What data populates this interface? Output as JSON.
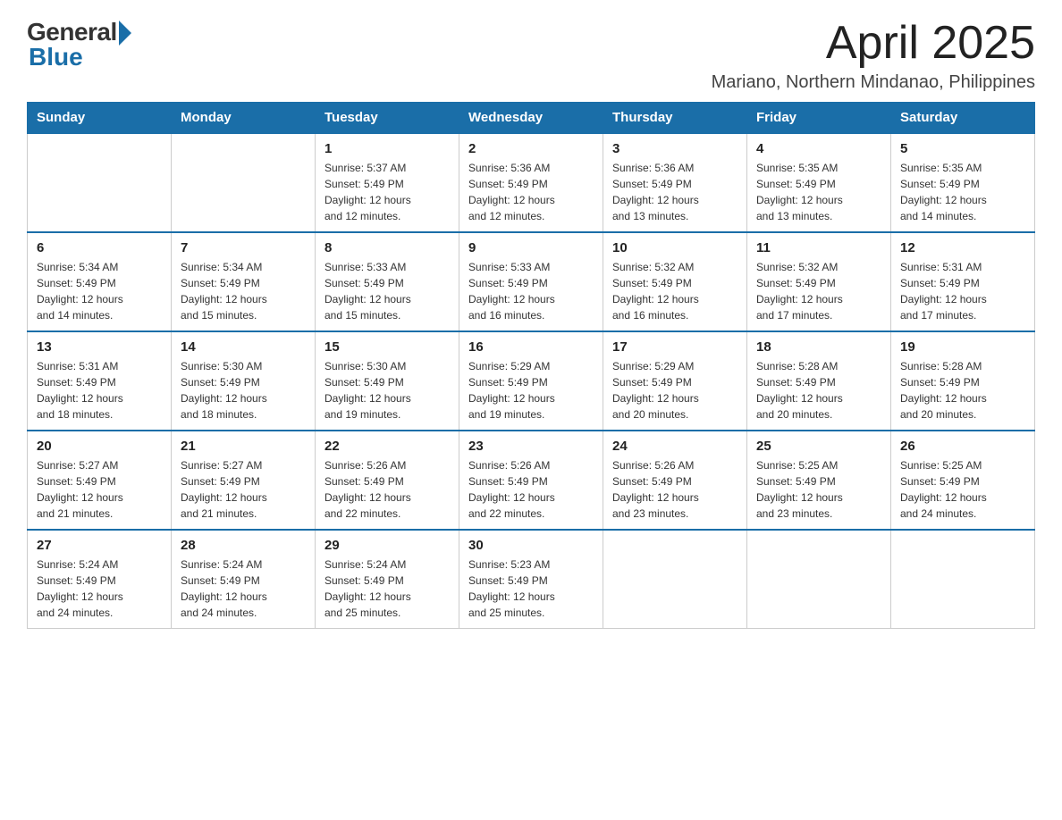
{
  "header": {
    "logo_general": "General",
    "logo_blue": "Blue",
    "month_year": "April 2025",
    "location": "Mariano, Northern Mindanao, Philippines"
  },
  "days_of_week": [
    "Sunday",
    "Monday",
    "Tuesday",
    "Wednesday",
    "Thursday",
    "Friday",
    "Saturday"
  ],
  "weeks": [
    [
      {
        "day": "",
        "info": ""
      },
      {
        "day": "",
        "info": ""
      },
      {
        "day": "1",
        "info": "Sunrise: 5:37 AM\nSunset: 5:49 PM\nDaylight: 12 hours\nand 12 minutes."
      },
      {
        "day": "2",
        "info": "Sunrise: 5:36 AM\nSunset: 5:49 PM\nDaylight: 12 hours\nand 12 minutes."
      },
      {
        "day": "3",
        "info": "Sunrise: 5:36 AM\nSunset: 5:49 PM\nDaylight: 12 hours\nand 13 minutes."
      },
      {
        "day": "4",
        "info": "Sunrise: 5:35 AM\nSunset: 5:49 PM\nDaylight: 12 hours\nand 13 minutes."
      },
      {
        "day": "5",
        "info": "Sunrise: 5:35 AM\nSunset: 5:49 PM\nDaylight: 12 hours\nand 14 minutes."
      }
    ],
    [
      {
        "day": "6",
        "info": "Sunrise: 5:34 AM\nSunset: 5:49 PM\nDaylight: 12 hours\nand 14 minutes."
      },
      {
        "day": "7",
        "info": "Sunrise: 5:34 AM\nSunset: 5:49 PM\nDaylight: 12 hours\nand 15 minutes."
      },
      {
        "day": "8",
        "info": "Sunrise: 5:33 AM\nSunset: 5:49 PM\nDaylight: 12 hours\nand 15 minutes."
      },
      {
        "day": "9",
        "info": "Sunrise: 5:33 AM\nSunset: 5:49 PM\nDaylight: 12 hours\nand 16 minutes."
      },
      {
        "day": "10",
        "info": "Sunrise: 5:32 AM\nSunset: 5:49 PM\nDaylight: 12 hours\nand 16 minutes."
      },
      {
        "day": "11",
        "info": "Sunrise: 5:32 AM\nSunset: 5:49 PM\nDaylight: 12 hours\nand 17 minutes."
      },
      {
        "day": "12",
        "info": "Sunrise: 5:31 AM\nSunset: 5:49 PM\nDaylight: 12 hours\nand 17 minutes."
      }
    ],
    [
      {
        "day": "13",
        "info": "Sunrise: 5:31 AM\nSunset: 5:49 PM\nDaylight: 12 hours\nand 18 minutes."
      },
      {
        "day": "14",
        "info": "Sunrise: 5:30 AM\nSunset: 5:49 PM\nDaylight: 12 hours\nand 18 minutes."
      },
      {
        "day": "15",
        "info": "Sunrise: 5:30 AM\nSunset: 5:49 PM\nDaylight: 12 hours\nand 19 minutes."
      },
      {
        "day": "16",
        "info": "Sunrise: 5:29 AM\nSunset: 5:49 PM\nDaylight: 12 hours\nand 19 minutes."
      },
      {
        "day": "17",
        "info": "Sunrise: 5:29 AM\nSunset: 5:49 PM\nDaylight: 12 hours\nand 20 minutes."
      },
      {
        "day": "18",
        "info": "Sunrise: 5:28 AM\nSunset: 5:49 PM\nDaylight: 12 hours\nand 20 minutes."
      },
      {
        "day": "19",
        "info": "Sunrise: 5:28 AM\nSunset: 5:49 PM\nDaylight: 12 hours\nand 20 minutes."
      }
    ],
    [
      {
        "day": "20",
        "info": "Sunrise: 5:27 AM\nSunset: 5:49 PM\nDaylight: 12 hours\nand 21 minutes."
      },
      {
        "day": "21",
        "info": "Sunrise: 5:27 AM\nSunset: 5:49 PM\nDaylight: 12 hours\nand 21 minutes."
      },
      {
        "day": "22",
        "info": "Sunrise: 5:26 AM\nSunset: 5:49 PM\nDaylight: 12 hours\nand 22 minutes."
      },
      {
        "day": "23",
        "info": "Sunrise: 5:26 AM\nSunset: 5:49 PM\nDaylight: 12 hours\nand 22 minutes."
      },
      {
        "day": "24",
        "info": "Sunrise: 5:26 AM\nSunset: 5:49 PM\nDaylight: 12 hours\nand 23 minutes."
      },
      {
        "day": "25",
        "info": "Sunrise: 5:25 AM\nSunset: 5:49 PM\nDaylight: 12 hours\nand 23 minutes."
      },
      {
        "day": "26",
        "info": "Sunrise: 5:25 AM\nSunset: 5:49 PM\nDaylight: 12 hours\nand 24 minutes."
      }
    ],
    [
      {
        "day": "27",
        "info": "Sunrise: 5:24 AM\nSunset: 5:49 PM\nDaylight: 12 hours\nand 24 minutes."
      },
      {
        "day": "28",
        "info": "Sunrise: 5:24 AM\nSunset: 5:49 PM\nDaylight: 12 hours\nand 24 minutes."
      },
      {
        "day": "29",
        "info": "Sunrise: 5:24 AM\nSunset: 5:49 PM\nDaylight: 12 hours\nand 25 minutes."
      },
      {
        "day": "30",
        "info": "Sunrise: 5:23 AM\nSunset: 5:49 PM\nDaylight: 12 hours\nand 25 minutes."
      },
      {
        "day": "",
        "info": ""
      },
      {
        "day": "",
        "info": ""
      },
      {
        "day": "",
        "info": ""
      }
    ]
  ]
}
